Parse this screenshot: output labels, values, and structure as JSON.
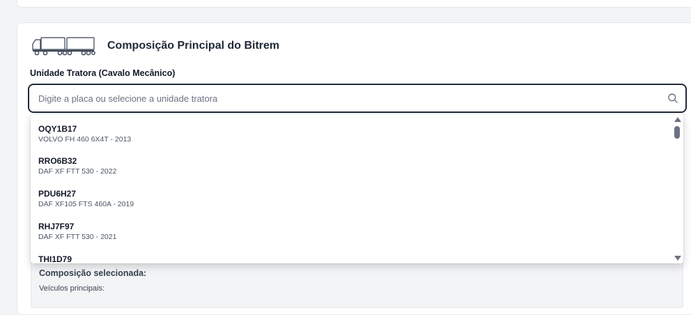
{
  "section": {
    "title": "Composição Principal do Bitrem",
    "icon": "bitrem-truck-icon"
  },
  "field": {
    "label": "Unidade Tratora (Cavalo Mecânico)",
    "placeholder": "Digite a placa ou selecione a unidade tratora",
    "value": ""
  },
  "dropdown": {
    "options": [
      {
        "plate": "OQY1B17",
        "description": "VOLVO FH 460 6X4T - 2013"
      },
      {
        "plate": "RRO6B32",
        "description": "DAF XF FTT 530 - 2022"
      },
      {
        "plate": "PDU6H27",
        "description": "DAF XF105 FTS 460A - 2019"
      },
      {
        "plate": "RHJ7F97",
        "description": "DAF XF FTT 530 - 2021"
      },
      {
        "plate": "THI1D79",
        "description": ""
      }
    ]
  },
  "selected": {
    "title": "Composição selecionada:",
    "subtitle": "Veículos principais:"
  },
  "colors": {
    "border_active": "#1f2937",
    "panel_bg": "#f3f4f6"
  }
}
